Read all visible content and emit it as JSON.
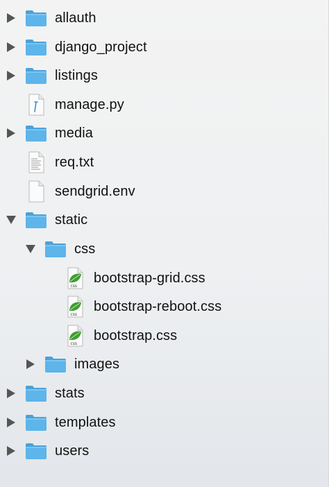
{
  "items": [
    {
      "label": "allauth",
      "type": "folder",
      "expanded": false,
      "icon": "folder-icon"
    },
    {
      "label": "django_project",
      "type": "folder",
      "expanded": false,
      "icon": "folder-icon"
    },
    {
      "label": "listings",
      "type": "folder",
      "expanded": false,
      "icon": "folder-icon"
    },
    {
      "label": "manage.py",
      "type": "file",
      "icon": "python-file-icon"
    },
    {
      "label": "media",
      "type": "folder",
      "expanded": false,
      "icon": "folder-icon"
    },
    {
      "label": "req.txt",
      "type": "file",
      "icon": "text-file-icon"
    },
    {
      "label": "sendgrid.env",
      "type": "file",
      "icon": "blank-file-icon"
    },
    {
      "label": "static",
      "type": "folder",
      "expanded": true,
      "icon": "folder-icon"
    },
    {
      "label": "css",
      "type": "folder",
      "expanded": true,
      "icon": "folder-icon"
    },
    {
      "label": "bootstrap-grid.css",
      "type": "file",
      "icon": "css-file-icon"
    },
    {
      "label": "bootstrap-reboot.css",
      "type": "file",
      "icon": "css-file-icon"
    },
    {
      "label": "bootstrap.css",
      "type": "file",
      "icon": "css-file-icon"
    },
    {
      "label": "images",
      "type": "folder",
      "expanded": false,
      "icon": "folder-icon"
    },
    {
      "label": "stats",
      "type": "folder",
      "expanded": false,
      "icon": "folder-icon"
    },
    {
      "label": "templates",
      "type": "folder",
      "expanded": false,
      "icon": "folder-icon"
    },
    {
      "label": "users",
      "type": "folder",
      "expanded": false,
      "icon": "folder-icon"
    }
  ],
  "colors": {
    "folder_body": "#5db5ea",
    "folder_tab": "#4aa2da",
    "triangle": "#555555"
  }
}
